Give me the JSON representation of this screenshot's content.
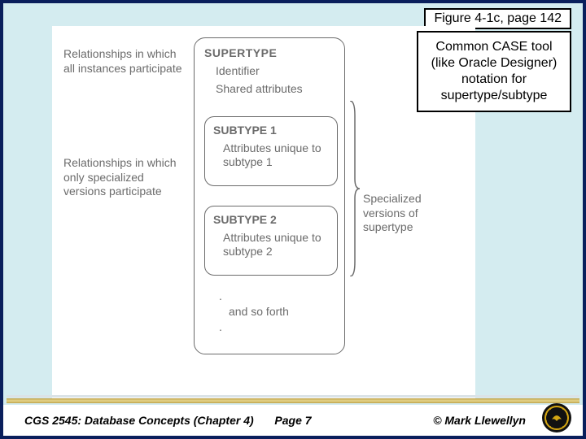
{
  "figref": "Figure 4-1c, page 142",
  "caption": "Common CASE tool (like Oracle Designer) notation for supertype/subtype",
  "labels": {
    "all_participate": "Relationships in which all instances participate",
    "specialized_participate": "Relationships in which only specialized versions participate",
    "specialized_versions": "Specialized versions of supertype"
  },
  "supertype": {
    "title": "SUPERTYPE",
    "rows": [
      "Identifier",
      "Shared attributes"
    ]
  },
  "subtypes": [
    {
      "title": "SUBTYPE 1",
      "attrs": "Attributes unique to subtype 1"
    },
    {
      "title": "SUBTYPE 2",
      "attrs": "Attributes unique to subtype 2"
    }
  ],
  "andsoforth": "and so forth",
  "footer": {
    "left": "CGS 2545: Database Concepts  (Chapter 4)",
    "mid": "Page 7",
    "right": "© Mark Llewellyn"
  }
}
